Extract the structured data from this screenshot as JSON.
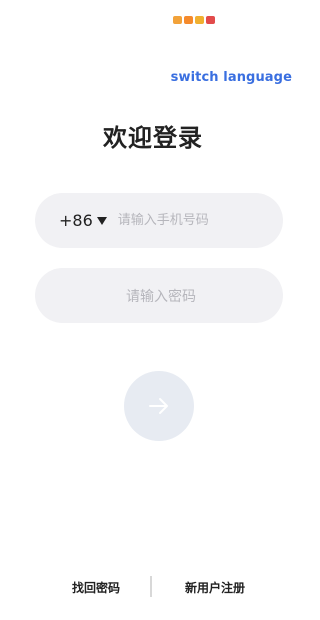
{
  "status_icons": [
    {
      "icon": "eye-notification-icon",
      "color": "#f2a23a"
    },
    {
      "icon": "message-notification-icon",
      "color": "#f58a2c"
    },
    {
      "icon": "image-notification-icon",
      "color": "#f0b030"
    },
    {
      "icon": "app-notification-icon",
      "color": "#e24b4b"
    }
  ],
  "header": {
    "switch_language": "switch language"
  },
  "title": "欢迎登录",
  "phone": {
    "country_code": "+86",
    "placeholder": "请输入手机号码",
    "value": ""
  },
  "password": {
    "placeholder": "请输入密码",
    "value": ""
  },
  "submit": {
    "icon": "arrow-right-icon"
  },
  "footer": {
    "find_password": "找回密码",
    "register": "新用户注册"
  },
  "colors": {
    "accent": "#3a6fe0",
    "field_bg": "#f1f1f4",
    "button_bg": "#e7ebf2",
    "placeholder": "#b6b6bc"
  }
}
